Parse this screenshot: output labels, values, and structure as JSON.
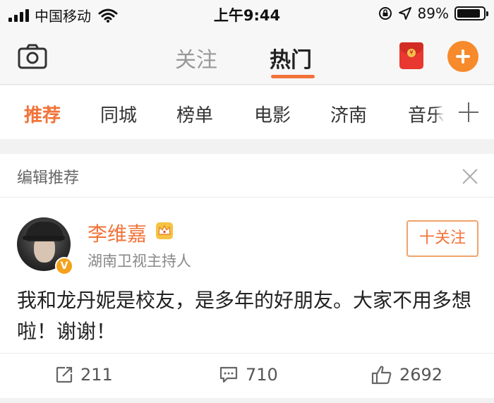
{
  "status_bar": {
    "carrier": "中国移动",
    "time": "上午9:44",
    "battery_percent": "89%",
    "battery_level": 0.89
  },
  "nav": {
    "tab_follow": "关注",
    "tab_hot": "热门",
    "icons": [
      "camera-icon",
      "red-packet-icon",
      "plus-icon"
    ],
    "accent_color": "#f27339"
  },
  "categories": {
    "items": [
      "推荐",
      "同城",
      "榜单",
      "电影",
      "济南",
      "音乐"
    ],
    "active": "推荐"
  },
  "card": {
    "header_title": "编辑推荐",
    "user": {
      "name": "李维嘉",
      "verified_badge": "V",
      "description": "湖南卫视主持人"
    },
    "follow_label": "十关注",
    "post_text": "我和龙丹妮是校友，是多年的好朋友。大家不用多想啦！谢谢！",
    "actions": {
      "repost_count": "211",
      "comment_count": "710",
      "like_count": "2692"
    }
  }
}
